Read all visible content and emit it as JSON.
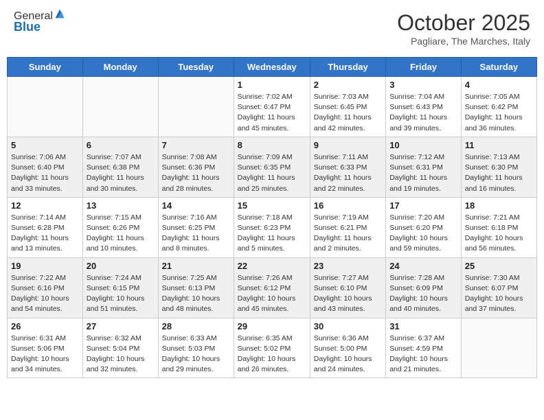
{
  "header": {
    "logo_line1": "General",
    "logo_line2": "Blue",
    "month_title": "October 2025",
    "location": "Pagliare, The Marches, Italy"
  },
  "days_of_week": [
    "Sunday",
    "Monday",
    "Tuesday",
    "Wednesday",
    "Thursday",
    "Friday",
    "Saturday"
  ],
  "weeks": [
    [
      {
        "date": "",
        "info": ""
      },
      {
        "date": "",
        "info": ""
      },
      {
        "date": "",
        "info": ""
      },
      {
        "date": "1",
        "info": "Sunrise: 7:02 AM\nSunset: 6:47 PM\nDaylight: 11 hours and 45 minutes."
      },
      {
        "date": "2",
        "info": "Sunrise: 7:03 AM\nSunset: 6:45 PM\nDaylight: 11 hours and 42 minutes."
      },
      {
        "date": "3",
        "info": "Sunrise: 7:04 AM\nSunset: 6:43 PM\nDaylight: 11 hours and 39 minutes."
      },
      {
        "date": "4",
        "info": "Sunrise: 7:05 AM\nSunset: 6:42 PM\nDaylight: 11 hours and 36 minutes."
      }
    ],
    [
      {
        "date": "5",
        "info": "Sunrise: 7:06 AM\nSunset: 6:40 PM\nDaylight: 11 hours and 33 minutes."
      },
      {
        "date": "6",
        "info": "Sunrise: 7:07 AM\nSunset: 6:38 PM\nDaylight: 11 hours and 30 minutes."
      },
      {
        "date": "7",
        "info": "Sunrise: 7:08 AM\nSunset: 6:36 PM\nDaylight: 11 hours and 28 minutes."
      },
      {
        "date": "8",
        "info": "Sunrise: 7:09 AM\nSunset: 6:35 PM\nDaylight: 11 hours and 25 minutes."
      },
      {
        "date": "9",
        "info": "Sunrise: 7:11 AM\nSunset: 6:33 PM\nDaylight: 11 hours and 22 minutes."
      },
      {
        "date": "10",
        "info": "Sunrise: 7:12 AM\nSunset: 6:31 PM\nDaylight: 11 hours and 19 minutes."
      },
      {
        "date": "11",
        "info": "Sunrise: 7:13 AM\nSunset: 6:30 PM\nDaylight: 11 hours and 16 minutes."
      }
    ],
    [
      {
        "date": "12",
        "info": "Sunrise: 7:14 AM\nSunset: 6:28 PM\nDaylight: 11 hours and 13 minutes."
      },
      {
        "date": "13",
        "info": "Sunrise: 7:15 AM\nSunset: 6:26 PM\nDaylight: 11 hours and 10 minutes."
      },
      {
        "date": "14",
        "info": "Sunrise: 7:16 AM\nSunset: 6:25 PM\nDaylight: 11 hours and 8 minutes."
      },
      {
        "date": "15",
        "info": "Sunrise: 7:18 AM\nSunset: 6:23 PM\nDaylight: 11 hours and 5 minutes."
      },
      {
        "date": "16",
        "info": "Sunrise: 7:19 AM\nSunset: 6:21 PM\nDaylight: 11 hours and 2 minutes."
      },
      {
        "date": "17",
        "info": "Sunrise: 7:20 AM\nSunset: 6:20 PM\nDaylight: 10 hours and 59 minutes."
      },
      {
        "date": "18",
        "info": "Sunrise: 7:21 AM\nSunset: 6:18 PM\nDaylight: 10 hours and 56 minutes."
      }
    ],
    [
      {
        "date": "19",
        "info": "Sunrise: 7:22 AM\nSunset: 6:16 PM\nDaylight: 10 hours and 54 minutes."
      },
      {
        "date": "20",
        "info": "Sunrise: 7:24 AM\nSunset: 6:15 PM\nDaylight: 10 hours and 51 minutes."
      },
      {
        "date": "21",
        "info": "Sunrise: 7:25 AM\nSunset: 6:13 PM\nDaylight: 10 hours and 48 minutes."
      },
      {
        "date": "22",
        "info": "Sunrise: 7:26 AM\nSunset: 6:12 PM\nDaylight: 10 hours and 45 minutes."
      },
      {
        "date": "23",
        "info": "Sunrise: 7:27 AM\nSunset: 6:10 PM\nDaylight: 10 hours and 43 minutes."
      },
      {
        "date": "24",
        "info": "Sunrise: 7:28 AM\nSunset: 6:09 PM\nDaylight: 10 hours and 40 minutes."
      },
      {
        "date": "25",
        "info": "Sunrise: 7:30 AM\nSunset: 6:07 PM\nDaylight: 10 hours and 37 minutes."
      }
    ],
    [
      {
        "date": "26",
        "info": "Sunrise: 6:31 AM\nSunset: 5:06 PM\nDaylight: 10 hours and 34 minutes."
      },
      {
        "date": "27",
        "info": "Sunrise: 6:32 AM\nSunset: 5:04 PM\nDaylight: 10 hours and 32 minutes."
      },
      {
        "date": "28",
        "info": "Sunrise: 6:33 AM\nSunset: 5:03 PM\nDaylight: 10 hours and 29 minutes."
      },
      {
        "date": "29",
        "info": "Sunrise: 6:35 AM\nSunset: 5:02 PM\nDaylight: 10 hours and 26 minutes."
      },
      {
        "date": "30",
        "info": "Sunrise: 6:36 AM\nSunset: 5:00 PM\nDaylight: 10 hours and 24 minutes."
      },
      {
        "date": "31",
        "info": "Sunrise: 6:37 AM\nSunset: 4:59 PM\nDaylight: 10 hours and 21 minutes."
      },
      {
        "date": "",
        "info": ""
      }
    ]
  ]
}
